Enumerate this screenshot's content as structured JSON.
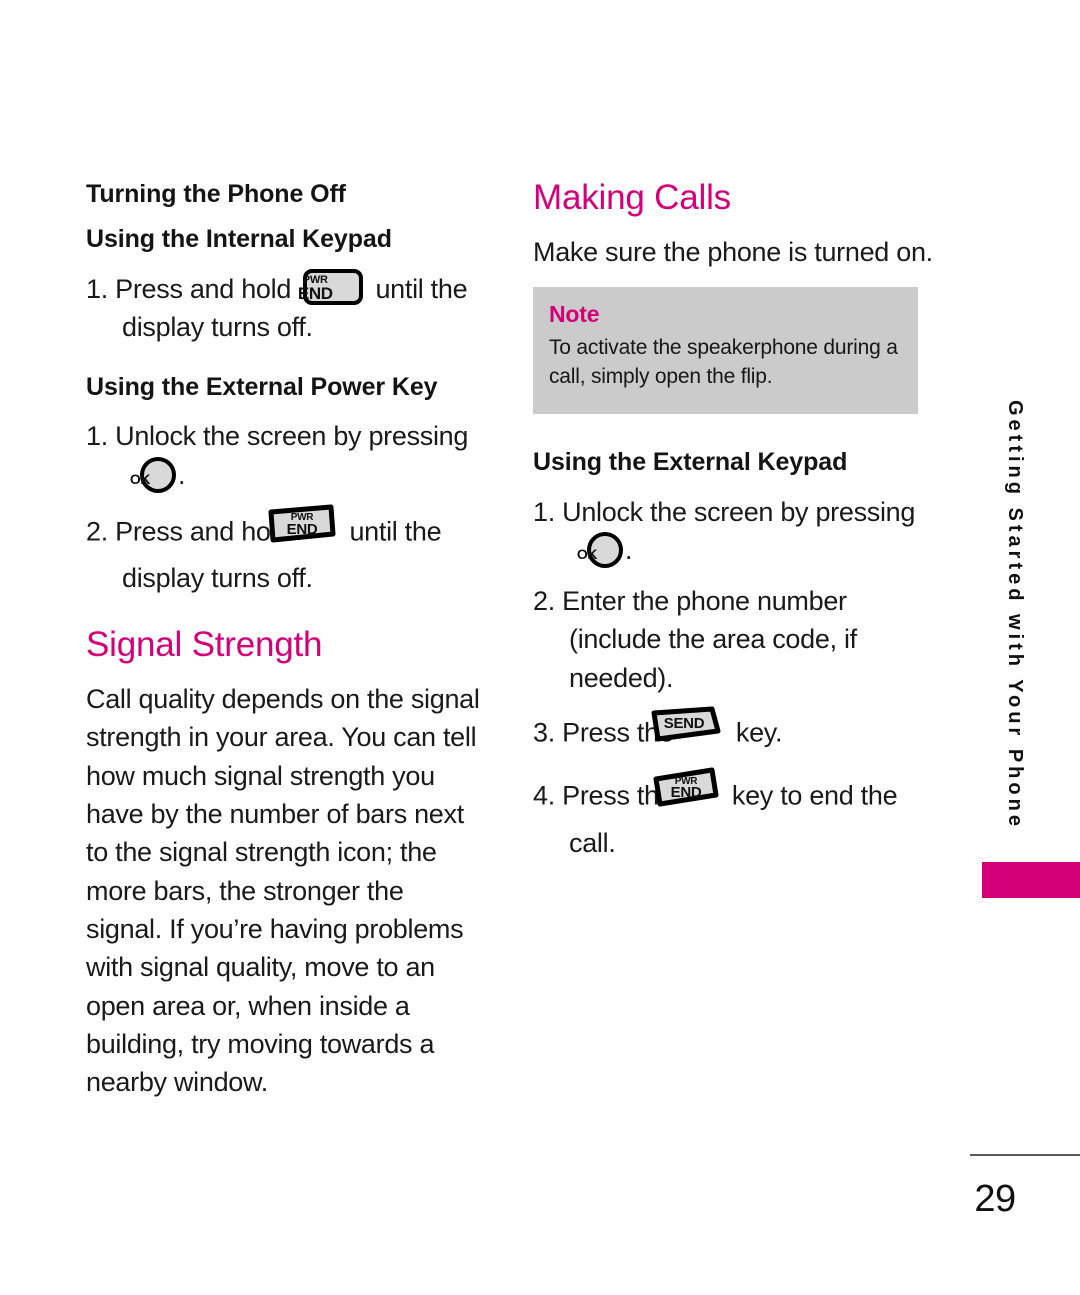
{
  "page": {
    "number": "29",
    "side_tab_label": "Getting Started with Your Phone",
    "accent_color": "#d4007a",
    "note_bg_color": "#cbcbcb",
    "key_fill_color": "#d9d9d9"
  },
  "left_column": {
    "heading": "Turning the Phone Off",
    "internal_keypad": {
      "heading": "Using the Internal Keypad",
      "steps": [
        {
          "number": "1.",
          "text_before": "Press and hold",
          "key": "pwr-end-internal",
          "text_after": "until the display turns off."
        }
      ]
    },
    "external_power_key": {
      "heading": "Using the External Power Key",
      "steps": [
        {
          "number": "1.",
          "text_before": "Unlock the screen by pressing",
          "key": "ok",
          "text_after": "."
        },
        {
          "number": "2.",
          "text_before": "Press and hold",
          "key": "pwr-end-external",
          "text_after": "until the display turns off."
        }
      ]
    },
    "signal_strength": {
      "heading": "Signal Strength",
      "body": "Call quality depends on the signal strength in your area. You can tell how much signal strength you have by the number of bars next to the signal strength icon; the more bars, the stronger the signal. If you’re having problems with signal quality, move to an open area or, when inside a building, try moving towards a nearby window."
    }
  },
  "right_column": {
    "heading": "Making Calls",
    "intro": "Make sure the phone is turned on.",
    "note": {
      "label": "Note",
      "body": "To activate the speakerphone during a call, simply open the flip."
    },
    "external_keypad": {
      "heading": "Using the External Keypad",
      "steps": [
        {
          "number": "1.",
          "text_before": "Unlock the screen by pressing",
          "key": "ok",
          "text_after": "."
        },
        {
          "number": "2.",
          "text_before": "Enter the phone number (include the area code, if needed).",
          "key": null,
          "text_after": ""
        },
        {
          "number": "3.",
          "text_before": "Press the",
          "key": "send",
          "text_after": "key."
        },
        {
          "number": "4.",
          "text_before": "Press the",
          "key": "pwr-end-external",
          "text_after": "key to end the call."
        }
      ]
    }
  },
  "key_labels": {
    "pwr_top": "PWR",
    "end_bottom": "END",
    "ok": "OK",
    "send": "SEND"
  }
}
